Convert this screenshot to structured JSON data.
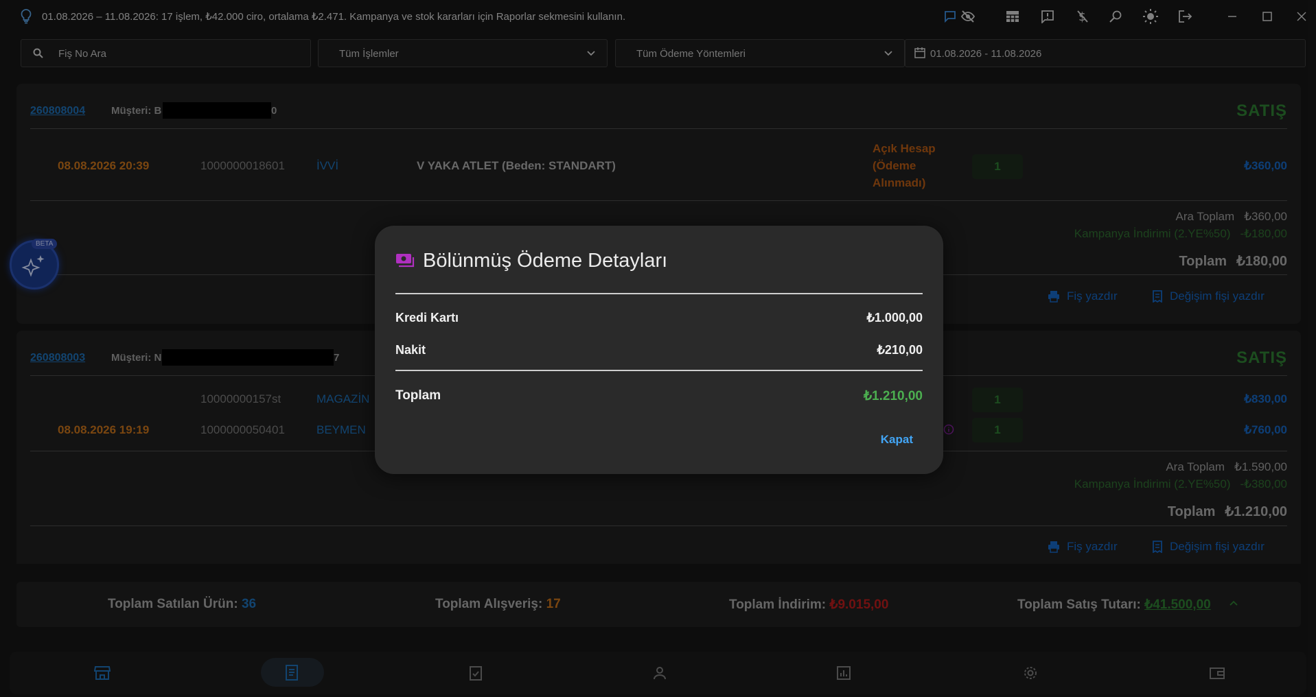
{
  "topbar": {
    "info_text": "01.08.2026 – 11.08.2026: 17 işlem, ₺42.000 ciro, ortalama ₺2.471. Kampanya ve stok kararları için Raporlar sekmesini kullanın.",
    "icons": [
      "lightbulb-icon",
      "chat-icon",
      "eye-off-icon",
      "grid-icon",
      "feedback-icon",
      "money-off-icon",
      "search-person-icon",
      "sun-icon",
      "logout-icon",
      "minimize-icon",
      "maximize-icon",
      "close-icon"
    ]
  },
  "filters": {
    "search_placeholder": "Fiş No Ara",
    "type_select": "Tüm İşlemler",
    "payment_select": "Tüm Ödeme Yöntemleri",
    "date_range": "01.08.2026 - 11.08.2026"
  },
  "receipts": [
    {
      "id": "260808004",
      "customer_label": "Müşteri: B",
      "customer_tail": "0",
      "type": "SATIŞ",
      "items": [
        {
          "date": "08.08.2026 20:39",
          "barcode": "1000000018601",
          "brand": "İVVİ",
          "product": "V YAKA ATLET (Beden: STANDART)",
          "payment_status": [
            "Açık Hesap",
            "(Ödeme",
            "Alınmadı)"
          ],
          "qty": "1",
          "price": "₺360,00"
        }
      ],
      "subtotal_label": "Ara Toplam",
      "subtotal": "₺360,00",
      "discount_label": "Kampanya İndirimi (2.YE%50)",
      "discount": "-₺180,00",
      "total_label": "Toplam",
      "total": "₺180,00",
      "print_label": "Fiş yazdır",
      "exchange_label": "Değişim fişi yazdır"
    },
    {
      "id": "260808003",
      "customer_label": "Müşteri: N",
      "customer_tail": "7",
      "type": "SATIŞ",
      "items": [
        {
          "date": "",
          "barcode": "10000000157st",
          "brand": "MAGAZİN",
          "qty": "1",
          "price": "₺830,00"
        },
        {
          "date": "08.08.2026 19:19",
          "barcode": "1000000050401",
          "brand": "BEYMEN",
          "qty": "1",
          "price": "₺760,00"
        }
      ],
      "subtotal_label": "Ara Toplam",
      "subtotal": "₺1.590,00",
      "discount_label": "Kampanya İndirimi (2.YE%50)",
      "discount": "-₺380,00",
      "total_label": "Toplam",
      "total": "₺1.210,00",
      "print_label": "Fiş yazdır",
      "exchange_label": "Değişim fişi yazdır"
    }
  ],
  "fab": {
    "badge": "BETA"
  },
  "totals": {
    "sold_label": "Toplam Satılan Ürün:",
    "sold_value": "36",
    "orders_label": "Toplam Alışveriş:",
    "orders_value": "17",
    "discount_label": "Toplam İndirim:",
    "discount_value": "₺9.015,00",
    "sales_label": "Toplam Satış Tutarı:",
    "sales_value": "₺41.500,00"
  },
  "dialog": {
    "title": "Bölünmüş Ödeme Detayları",
    "rows": [
      {
        "label": "Kredi Kartı",
        "amount": "₺1.000,00"
      },
      {
        "label": "Nakit",
        "amount": "₺210,00"
      }
    ],
    "total_label": "Toplam",
    "total_amount": "₺1.210,00",
    "close_label": "Kapat"
  },
  "colors": {
    "accent_blue": "#1e6fb5",
    "sale_green": "#2e7d32",
    "date_orange": "#c6711b",
    "dialog_icon": "#b030c0"
  }
}
